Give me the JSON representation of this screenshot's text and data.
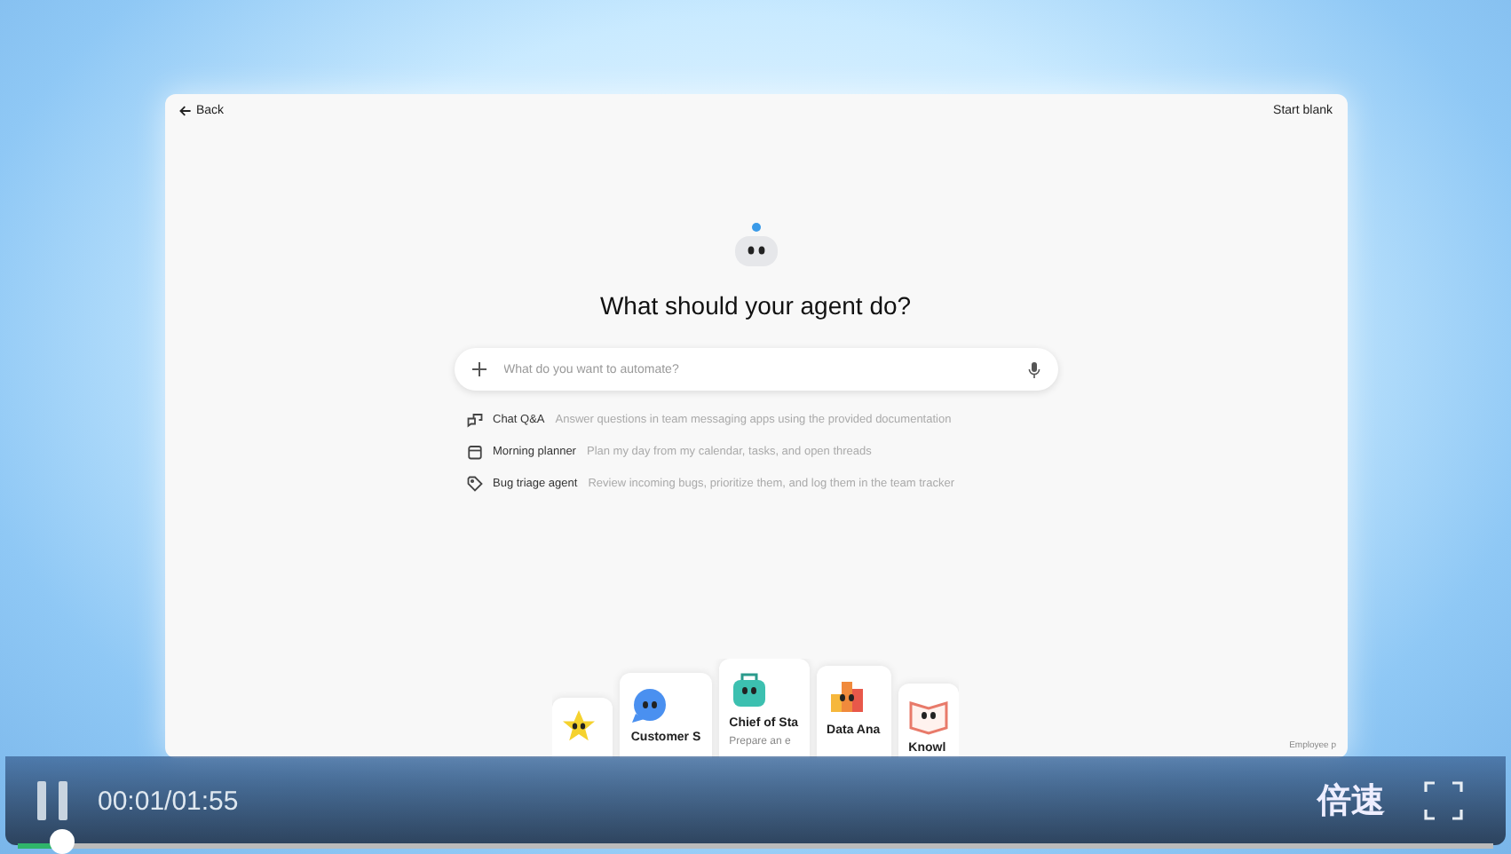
{
  "app": {
    "back": "Back",
    "start_blank": "Start blank",
    "heading": "What should your agent do?",
    "input": {
      "placeholder": "What do you want to automate?"
    },
    "suggestions": [
      {
        "kind": "chat",
        "title": "Chat Q&A",
        "description": "Answer questions in team messaging apps using the provided documentation"
      },
      {
        "kind": "calendar",
        "title": "Morning planner",
        "description": "Plan my day from my calendar, tasks, and open threads"
      },
      {
        "kind": "tag",
        "title": "Bug triage agent",
        "description": "Review incoming bugs, prioritize them, and log them in the team tracker"
      }
    ],
    "cards": [
      {
        "kind": "star"
      },
      {
        "kind": "bubble",
        "title": "Customer S"
      },
      {
        "kind": "case",
        "title": "Chief of Sta",
        "subtitle": "Prepare an e"
      },
      {
        "kind": "chart",
        "title": "Data Ana"
      },
      {
        "kind": "book",
        "title": "Knowl"
      }
    ],
    "footer_note": "Employee p"
  },
  "player": {
    "time": "00:01/01:55",
    "speed": "倍速",
    "playing": true,
    "level": 0.03
  }
}
